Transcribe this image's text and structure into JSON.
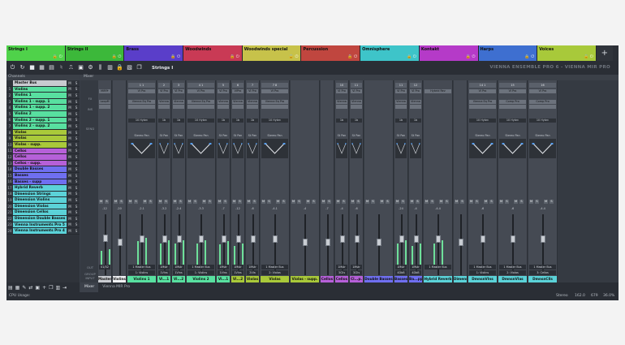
{
  "tabs": [
    {
      "label": "Strings I",
      "color": "#4fd24a"
    },
    {
      "label": "Strings II",
      "color": "#3cb83a"
    },
    {
      "label": "Brass",
      "color": "#5a3ec9"
    },
    {
      "label": "Woodwinds",
      "color": "#c93a55"
    },
    {
      "label": "Woodwinds special",
      "color": "#c7c24a"
    },
    {
      "label": "Percussion",
      "color": "#c0463f"
    },
    {
      "label": "Omnisphere",
      "color": "#3ec4c9"
    },
    {
      "label": "Kontakt",
      "color": "#b53ac8"
    },
    {
      "label": "Harps",
      "color": "#3e6fd0"
    },
    {
      "label": "Voices",
      "color": "#a8c93a"
    }
  ],
  "tab_add_label": "+",
  "toolbar": {
    "title": "Strings I",
    "brand": "VIENNA ENSEMBLE PRO 6 - VIENNA MIR PRO"
  },
  "channels_title": "Channels",
  "channels": [
    {
      "num": "",
      "name": "Master Bus",
      "color": "#c8cbd0"
    },
    {
      "num": "1",
      "name": "Violins",
      "color": "#58e0a0"
    },
    {
      "num": "2",
      "name": "Violins 1",
      "color": "#58e0a0"
    },
    {
      "num": "3",
      "name": "Violins 1 - supp. 1",
      "color": "#58e0a0"
    },
    {
      "num": "4",
      "name": "Violins 1 - supp. 2",
      "color": "#58e0a0"
    },
    {
      "num": "5",
      "name": "Violins 2",
      "color": "#58e0a0"
    },
    {
      "num": "6",
      "name": "Violins 2 - supp. 1",
      "color": "#58e0a0"
    },
    {
      "num": "7",
      "name": "Violins 2 - supp. 2",
      "color": "#58e0a0"
    },
    {
      "num": "8",
      "name": "Violas",
      "color": "#a9c93a"
    },
    {
      "num": "9",
      "name": "Violas",
      "color": "#a9c93a"
    },
    {
      "num": "10",
      "name": "Violas - supp.",
      "color": "#a9c93a"
    },
    {
      "num": "11",
      "name": "Cellos",
      "color": "#b660d8"
    },
    {
      "num": "12",
      "name": "Cellos",
      "color": "#b660d8"
    },
    {
      "num": "13",
      "name": "Cellos - supp.",
      "color": "#b660d8"
    },
    {
      "num": "14",
      "name": "Double Basses",
      "color": "#6f6ff0"
    },
    {
      "num": "15",
      "name": "Basses",
      "color": "#6f6ff0"
    },
    {
      "num": "16",
      "name": "Basses - supp",
      "color": "#6f6ff0"
    },
    {
      "num": "17",
      "name": "Hybrid Reverb",
      "color": "#5bd2d8"
    },
    {
      "num": "18",
      "name": "Dimension Strings",
      "color": "#5bd2d8"
    },
    {
      "num": "19",
      "name": "Dimension Violins",
      "color": "#5bd2d8"
    },
    {
      "num": "20",
      "name": "Dimension Violas",
      "color": "#5bd2d8"
    },
    {
      "num": "21",
      "name": "Dimension Cellos",
      "color": "#5bd2d8"
    },
    {
      "num": "22",
      "name": "Dimension Double Basses",
      "color": "#5bd2d8"
    },
    {
      "num": "23",
      "name": "Vienna Instruments Pro 5",
      "color": "#5bd2d8"
    },
    {
      "num": "24",
      "name": "Vienna Instruments Pro 4",
      "color": "#5bd2d8"
    }
  ],
  "mixer_title": "Mixer",
  "row_labels": {
    "fx": "FX",
    "ins": "INS",
    "send": "SEND",
    "out": "OUT",
    "group": "GROUP\nINPUT"
  },
  "strips": [
    {
      "name": "Master",
      "color": "#c8cbd0",
      "io": "",
      "plug1": "MIRPr",
      "plug2": "LoopM",
      "send": "",
      "pan": "",
      "vol": "-12",
      "out": "01/02",
      "in": "",
      "fader": 0.62,
      "meter": 0.35,
      "wide": false
    },
    {
      "name": "Violins",
      "color": "#f0f2f5",
      "io": "",
      "plug1": "",
      "plug2": "",
      "send": "",
      "pan": "",
      "vol": "-20",
      "out": "",
      "in": "",
      "fader": 0.55,
      "meter": 0.0,
      "wide": false
    },
    {
      "name": "Violins 1",
      "color": "#58e0a0",
      "io": "1 1",
      "plug1": "VI Pro",
      "plug2": "Vienna Eq Pro",
      "send": "10 Hybrc",
      "pan": "Stereo Pan",
      "vol": "-2.1",
      "out": "1 Master Bus",
      "in": "1: Violins",
      "fader": 0.6,
      "meter": 0.55,
      "wide": true
    },
    {
      "name": "Vi...1",
      "color": "#58e0a0",
      "io": "2",
      "plug1": "VI Pro",
      "plug2": "Vienna",
      "send": "1b",
      "pan": "St Pan",
      "vol": "-3.2",
      "out": "1Mstr",
      "in": "1Vlns",
      "fader": 0.6,
      "meter": 0.5,
      "wide": false
    },
    {
      "name": "Vi...2",
      "color": "#58e0a0",
      "io": "3",
      "plug1": "VI Pro",
      "plug2": "Vienna",
      "send": "1b",
      "pan": "St Pan",
      "vol": "-2.4",
      "out": "1Mstr",
      "in": "1Vlns",
      "fader": 0.6,
      "meter": 0.5,
      "wide": false
    },
    {
      "name": "Violins 2",
      "color": "#58e0a0",
      "io": "4 1",
      "plug1": "VI Pro",
      "plug2": "Vienna Eq Pro",
      "send": "10 Hybrc",
      "pan": "Stereo Pan",
      "vol": "-3.3",
      "out": "1 Master Bus",
      "in": "1: Violins",
      "fader": 0.6,
      "meter": 0.5,
      "wide": true
    },
    {
      "name": "Vi...1",
      "color": "#58e0a0",
      "io": "5",
      "plug1": "VI Pro",
      "plug2": "Vienna",
      "send": "1b",
      "pan": "St Pan",
      "vol": "-7",
      "out": "1Mstr",
      "in": "1Vlns",
      "fader": 0.6,
      "meter": 0.48,
      "wide": false
    },
    {
      "name": "Vi...2",
      "color": "#a9c93a",
      "io": "6",
      "plug1": "VIPro",
      "plug2": "Vienna",
      "send": "1b",
      "pan": "St Pan",
      "vol": "-12",
      "out": "1Mstr",
      "in": "1Vlns",
      "fader": 0.6,
      "meter": 0.45,
      "wide": false
    },
    {
      "name": "Violas",
      "color": "#a9c93a",
      "io": "7",
      "plug1": "VI Pro",
      "plug2": "Vienna",
      "send": "1b",
      "pan": "St Pan",
      "vol": "-6",
      "out": "1Mstr",
      "in": "2Vla",
      "fader": 0.6,
      "meter": 0.0,
      "wide": false
    },
    {
      "name": "Violas",
      "color": "#a9c93a",
      "io": "7 8",
      "plug1": "VI Pro",
      "plug2": "Vienna Eq Pro",
      "send": "10 Hybrc",
      "pan": "Stereo Pan",
      "vol": "-4.1",
      "out": "1 Master Bus",
      "in": "2: Violas",
      "fader": 0.6,
      "meter": 0.0,
      "wide": true
    },
    {
      "name": "Violas - supp.",
      "color": "#a9c93a",
      "io": "",
      "plug1": "",
      "plug2": "",
      "send": "",
      "pan": "",
      "vol": "-4",
      "out": "",
      "in": "",
      "fader": 0.55,
      "meter": 0.0,
      "wide": true
    },
    {
      "name": "Cellos",
      "color": "#b660d8",
      "io": "",
      "plug1": "",
      "plug2": "",
      "send": "",
      "pan": "",
      "vol": "-7",
      "out": "",
      "in": "",
      "fader": 0.55,
      "meter": 0.0,
      "wide": false
    },
    {
      "name": "Cellos",
      "color": "#b660d8",
      "io": "10",
      "plug1": "VI Pro",
      "plug2": "Vienna",
      "send": "1b",
      "pan": "St Pan",
      "vol": "-4",
      "out": "1Mstr",
      "in": "3Clls",
      "fader": 0.6,
      "meter": 0.0,
      "wide": false
    },
    {
      "name": "Cl...p.",
      "color": "#b660d8",
      "io": "11",
      "plug1": "VI Pro",
      "plug2": "Vienna",
      "send": "1b",
      "pan": "St Pan",
      "vol": "-6",
      "out": "1Mstr",
      "in": "3Clls",
      "fader": 0.6,
      "meter": 0.0,
      "wide": false
    },
    {
      "name": "Double Basses",
      "color": "#6f6ff0",
      "io": "",
      "plug1": "",
      "plug2": "",
      "send": "",
      "pan": "",
      "vol": "",
      "out": "",
      "in": "",
      "fader": 0.55,
      "meter": 0.0,
      "wide": true
    },
    {
      "name": "Basses",
      "color": "#6f6ff0",
      "io": "11",
      "plug1": "VI Pro",
      "plug2": "Vienna",
      "send": "1b",
      "pan": "St Pan",
      "vol": "-24",
      "out": "1Mstr",
      "in": "4DbB",
      "fader": 0.6,
      "meter": 0.5,
      "wide": false
    },
    {
      "name": "Ba...pp",
      "color": "#6f6ff0",
      "io": "12",
      "plug1": "VI Pro",
      "plug2": "Vienna",
      "send": "1b",
      "pan": "St Pan",
      "vol": "-4",
      "out": "1Mstr",
      "in": "4DbB",
      "fader": 0.6,
      "meter": 0.45,
      "wide": false
    },
    {
      "name": "Hybrid Reverb",
      "color": "#5bd2d8",
      "io": "",
      "plug1": "Hybrid Rev",
      "plug2": "",
      "send": "",
      "pan": "",
      "vol": "-4.4",
      "out": "1 Master Bus",
      "in": "",
      "fader": 0.6,
      "meter": 0.5,
      "wide": true
    },
    {
      "name": "Dimension Str",
      "color": "#5bd2d8",
      "io": "",
      "plug1": "",
      "plug2": "",
      "send": "",
      "pan": "",
      "vol": "",
      "out": "",
      "in": "",
      "fader": 0.55,
      "meter": 0.0,
      "wide": false
    },
    {
      "name": "DmnsnVlns",
      "color": "#5bd2d8",
      "io": "14 1",
      "plug1": "VI Pro",
      "plug2": "Vienna Eq Pro",
      "send": "10 Hybrc",
      "pan": "Stereo Pan",
      "vol": "-6",
      "out": "1 Master Bus",
      "in": "1: Violins",
      "fader": 0.6,
      "meter": 0.0,
      "wide": true
    },
    {
      "name": "DmnsnVlas",
      "color": "#5bd2d8",
      "io": "15",
      "plug1": "VI Pro",
      "plug2": "Comp Pro",
      "send": "10 Hybrc",
      "pan": "Stereo Pan",
      "vol": "-6",
      "out": "1 Master Bus",
      "in": "2: Violas",
      "fader": 0.6,
      "meter": 0.0,
      "wide": true
    },
    {
      "name": "DmnsnClls",
      "color": "#5bd2d8",
      "io": "16",
      "plug1": "VI Pro",
      "plug2": "Comp Pro",
      "send": "10 Hybrc",
      "pan": "Stereo Pan",
      "vol": "-4.4",
      "out": "1 Master Bus",
      "in": "3: Cellos",
      "fader": 0.6,
      "meter": 0.0,
      "wide": true
    }
  ],
  "bottom_tabs": [
    "Mixer",
    "Vienna MIR Pro"
  ],
  "status": {
    "cpu": "CPU Usage:",
    "mode": "Stereo",
    "sr": "162.0",
    "lat": "679",
    "pct": "36.0%"
  }
}
